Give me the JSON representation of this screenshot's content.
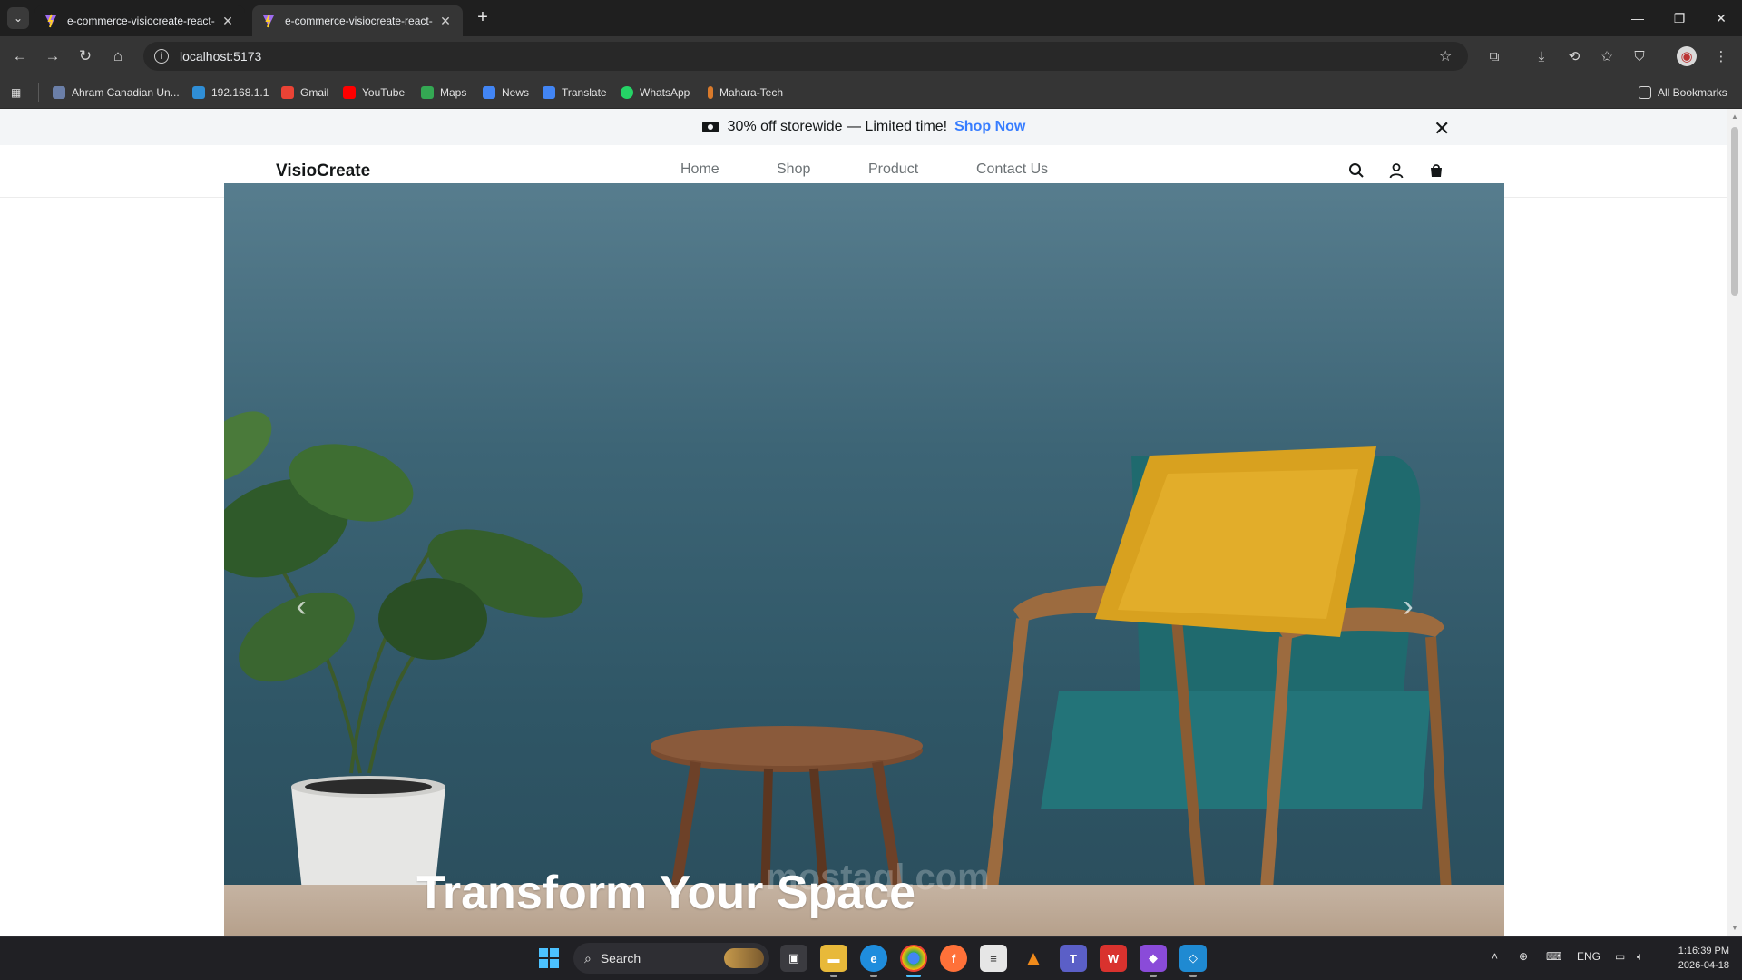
{
  "browser": {
    "tabs": [
      {
        "title": "e-commerce-visiocreate-react-",
        "active": false
      },
      {
        "title": "e-commerce-visiocreate-react-",
        "active": true
      }
    ],
    "url": "localhost:5173",
    "bookmarks": [
      {
        "label": "Ahram Canadian Un...",
        "icon": "university-icon",
        "color": "#6b7fa8"
      },
      {
        "label": "192.168.1.1",
        "icon": "network-icon",
        "color": "#2f8ed6"
      },
      {
        "label": "Gmail",
        "icon": "gmail-icon",
        "color": "#ea4335"
      },
      {
        "label": "YouTube",
        "icon": "youtube-icon",
        "color": "#ff0000"
      },
      {
        "label": "Maps",
        "icon": "maps-icon",
        "color": "#34a853"
      },
      {
        "label": "News",
        "icon": "news-icon",
        "color": "#4285f4"
      },
      {
        "label": "Translate",
        "icon": "translate-icon",
        "color": "#4285f4"
      },
      {
        "label": "WhatsApp",
        "icon": "whatsapp-icon",
        "color": "#25d366"
      },
      {
        "label": "Mahara-Tech",
        "icon": "mahara-icon",
        "color": "#d97a2b"
      }
    ],
    "all_bookmarks_label": "All Bookmarks"
  },
  "site": {
    "announcement": {
      "text": "30% off storewide — Limited time!",
      "link": "Shop Now"
    },
    "brand": "VisioCreate",
    "nav": [
      "Home",
      "Shop",
      "Product",
      "Contact Us"
    ],
    "hero": {
      "title": "Transform Your Space"
    },
    "colors": {
      "link": "#377dff",
      "text": "#141718",
      "muted": "#6c7275"
    }
  },
  "taskbar": {
    "search_label": "Search",
    "language": "ENG",
    "time": "1:16:39 PM",
    "date": "2026-04-18"
  },
  "watermark": "mostaql.com"
}
